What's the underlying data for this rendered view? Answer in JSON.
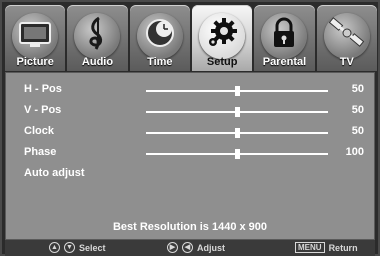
{
  "tabs": [
    {
      "label": "Picture",
      "icon": "tv-icon",
      "active": false
    },
    {
      "label": "Audio",
      "icon": "treble-clef-icon",
      "active": false
    },
    {
      "label": "Time",
      "icon": "clock-icon",
      "active": false
    },
    {
      "label": "Setup",
      "icon": "gear-icon",
      "active": true
    },
    {
      "label": "Parental",
      "icon": "lock-icon",
      "active": false
    },
    {
      "label": "TV",
      "icon": "satellite-icon",
      "active": false
    }
  ],
  "setup": {
    "items": [
      {
        "label": "H - Pos",
        "value": "50",
        "level": 0.5
      },
      {
        "label": "V - Pos",
        "value": "50",
        "level": 0.5
      },
      {
        "label": "Clock",
        "value": "50",
        "level": 0.5
      },
      {
        "label": "Phase",
        "value": "100",
        "level": 0.5
      }
    ],
    "auto_adjust_label": "Auto adjust",
    "best_resolution": "Best Resolution is 1440 x 900"
  },
  "hints": {
    "select": "Select",
    "adjust": "Adjust",
    "menu_key": "MENU",
    "return": "Return"
  },
  "colors": {
    "panel": "#8f8f8f",
    "active_tab": "#f0f0f0",
    "text": "#ffffff"
  }
}
